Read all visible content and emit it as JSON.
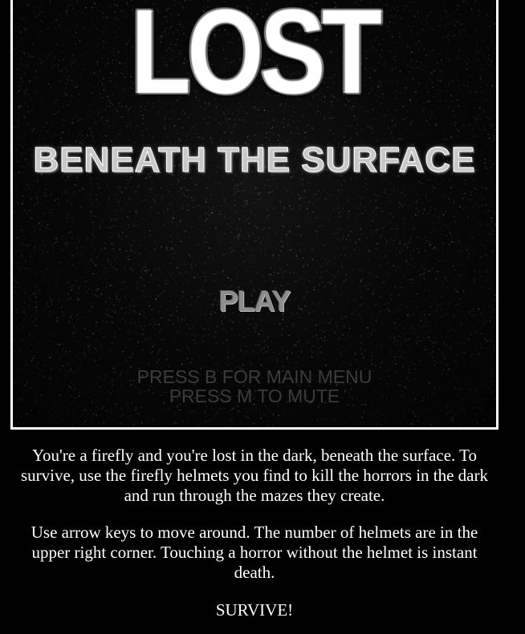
{
  "game": {
    "title": "LOST",
    "subtitle": "BENEATH THE SURFACE",
    "play_label": "PLAY",
    "hint_menu": "PRESS B FOR MAIN MENU",
    "hint_mute": "PRESS M TO MUTE"
  },
  "description": {
    "paragraph_1": "You're a firefly and you're lost in the dark, beneath the surface. To survive, use the firefly helmets you find to kill the horrors in the dark and run through the mazes they create.",
    "paragraph_2": "Use arrow keys to move around. The number of helmets are in the upper right corner. Touching a horror without the helmet is instant death.",
    "paragraph_3": "SURVIVE!"
  },
  "colors": {
    "page_background": "#000000",
    "frame_border": "#ffffff",
    "canvas_background": "#070707",
    "text": "#ffffff"
  }
}
